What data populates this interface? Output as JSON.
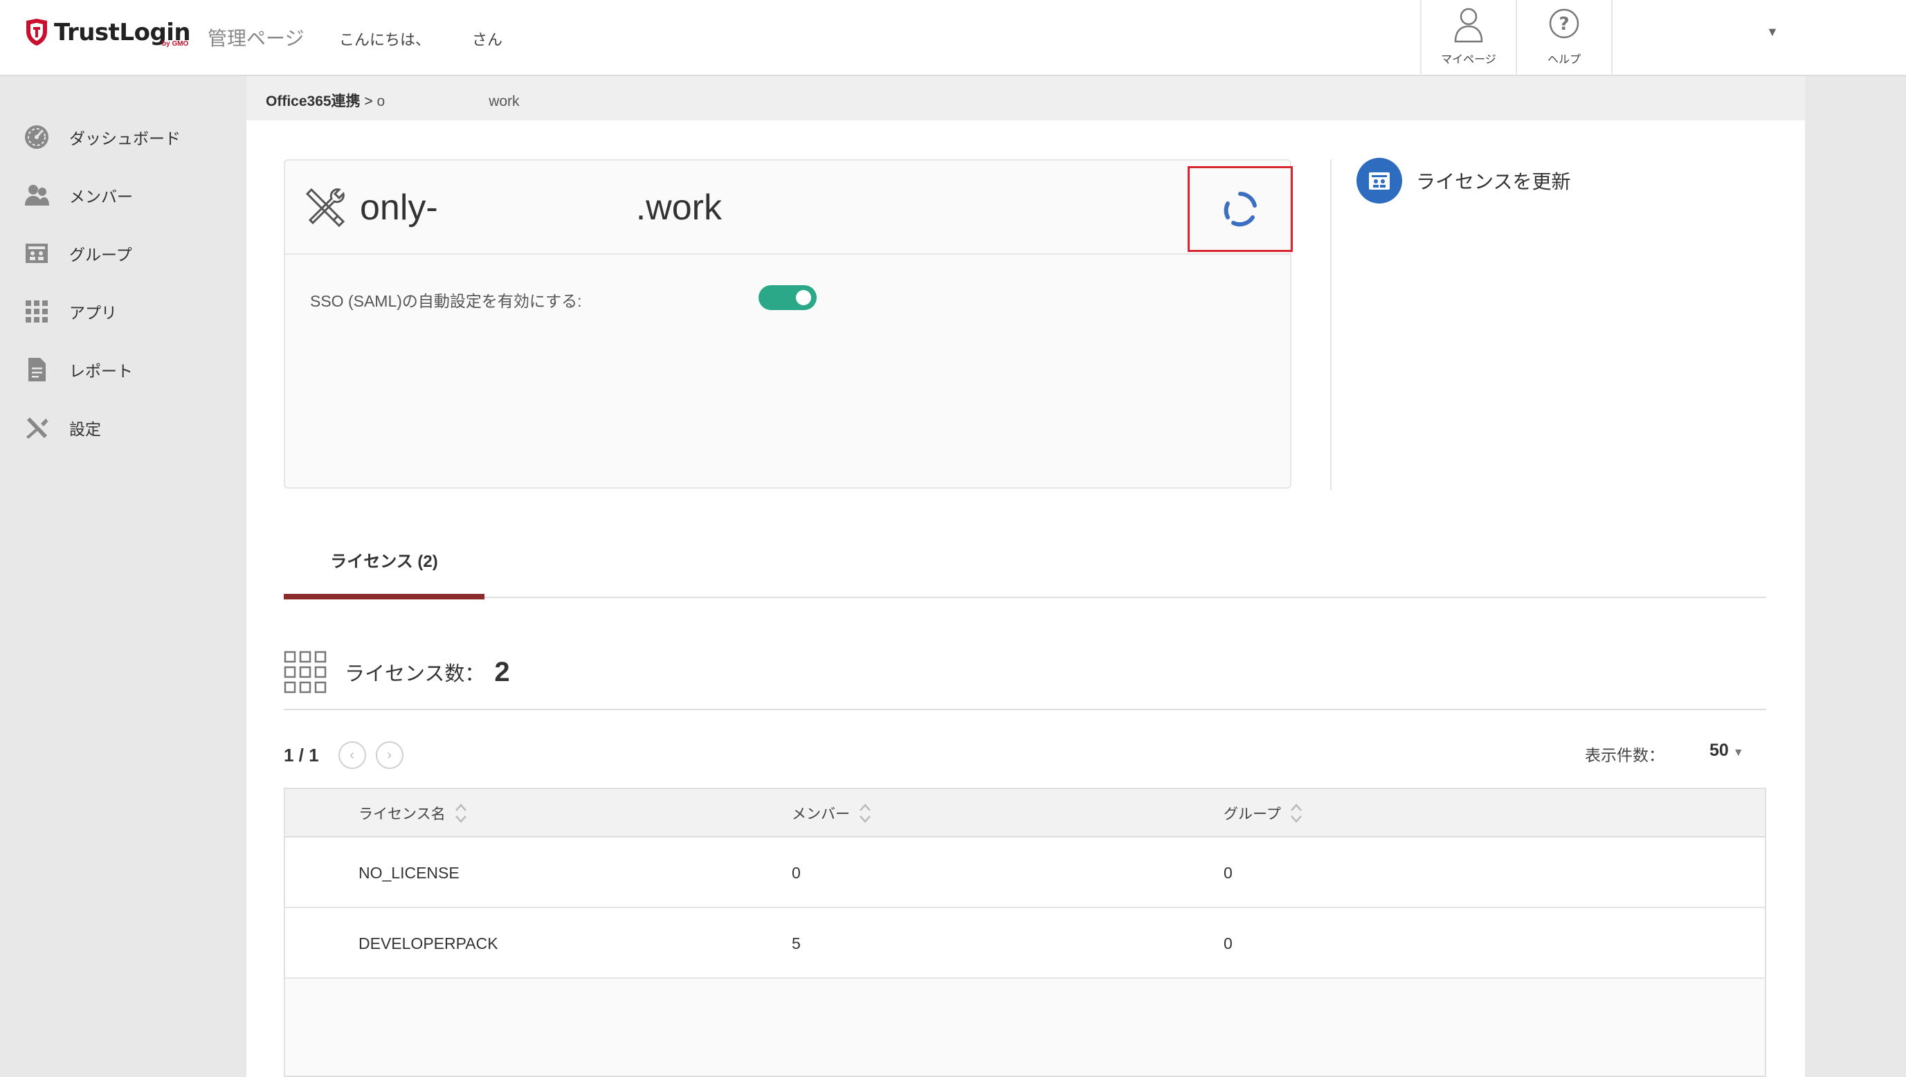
{
  "header": {
    "brand": "TrustLogin",
    "brand_sub": "by GMO",
    "admin_title": "管理ページ",
    "greeting_prefix": "こんにちは、",
    "greeting_suffix": "さん",
    "mypage_label": "マイページ",
    "help_label": "ヘルプ",
    "account_caret": "▼",
    "brand_color": "#c8102e"
  },
  "sidebar": {
    "items": [
      {
        "label": "ダッシュボード",
        "icon": "dashboard-icon"
      },
      {
        "label": "メンバー",
        "icon": "members-icon"
      },
      {
        "label": "グループ",
        "icon": "group-icon"
      },
      {
        "label": "アプリ",
        "icon": "apps-grid-icon"
      },
      {
        "label": "レポート",
        "icon": "report-icon"
      },
      {
        "label": "設定",
        "icon": "settings-tools-icon"
      }
    ]
  },
  "breadcrumb": {
    "root": "Office365連携",
    "separator": " > ",
    "tail_prefix": "o",
    "tail_suffix": "work"
  },
  "app": {
    "name_prefix": "only-",
    "name_suffix": ".work",
    "sso_label": "SSO (SAML)の自動設定を有効にする:",
    "sso_enabled": true,
    "toggle_color": "#2aa887",
    "highlight_color": "#d7262f"
  },
  "update_license": {
    "label": "ライセンスを更新",
    "icon": "license-update-icon",
    "color": "#2d6cbf"
  },
  "tabs": [
    {
      "label": "ライセンス (2)",
      "active": true
    }
  ],
  "license_count": {
    "label": "ライセンス数：",
    "value": "2"
  },
  "pager": {
    "page_indicator": "1 / 1",
    "prev": "‹",
    "next": "›",
    "per_page_label": "表示件数：",
    "per_page_value": "50",
    "per_page_caret": "▼"
  },
  "table": {
    "columns": [
      "ライセンス名",
      "メンバー",
      "グループ"
    ],
    "rows": [
      [
        "NO_LICENSE",
        "0",
        "0"
      ],
      [
        "DEVELOPERPACK",
        "5",
        "0"
      ]
    ]
  }
}
